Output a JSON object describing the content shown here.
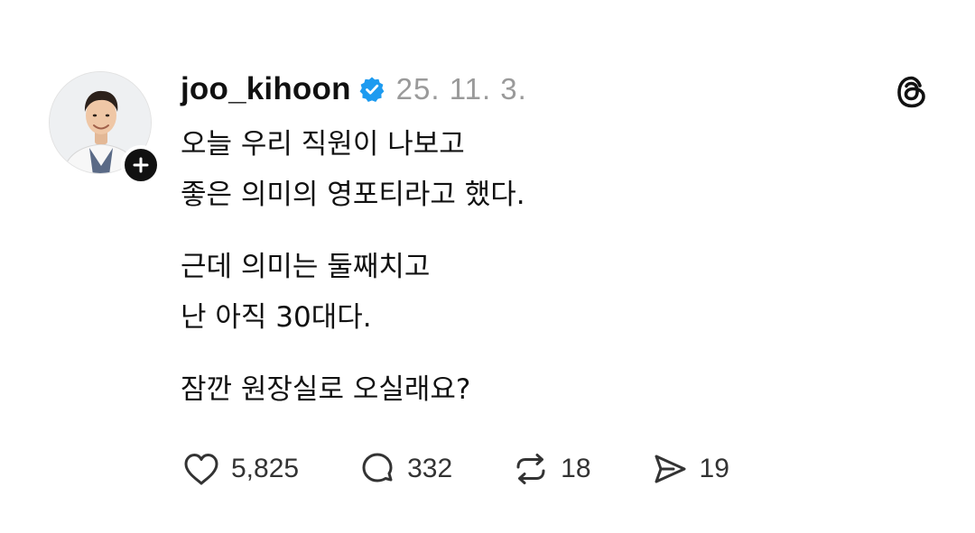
{
  "post": {
    "author": {
      "username": "joo_kihoon",
      "verified_icon": "verified-badge-icon",
      "avatar_icon": "profile-photo",
      "follow_icon": "plus-icon"
    },
    "date": "25. 11. 3.",
    "app_logo_icon": "threads-logo-icon",
    "paragraphs": [
      [
        "오늘 우리 직원이 나보고",
        "좋은 의미의 영포티라고 했다."
      ],
      [
        "근데 의미는 둘째치고",
        "난 아직 30대다."
      ],
      [
        "잠깐 원장실로 오실래요?"
      ]
    ],
    "actions": {
      "like": {
        "icon": "heart-icon",
        "count": "5,825"
      },
      "reply": {
        "icon": "comment-bubble-icon",
        "count": "332"
      },
      "repost": {
        "icon": "repost-icon",
        "count": "18"
      },
      "share": {
        "icon": "send-icon",
        "count": "19"
      }
    }
  },
  "colors": {
    "text": "#111111",
    "muted": "#9a9a9a",
    "verified_blue": "#1d9bf0",
    "background": "#ffffff"
  }
}
